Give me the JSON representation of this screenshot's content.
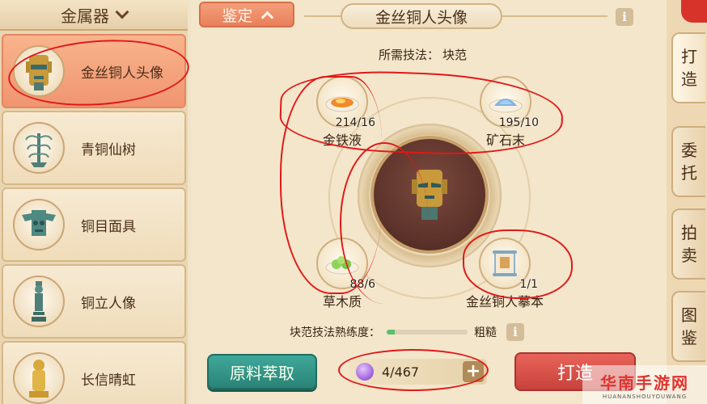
{
  "category": {
    "label": "金属器"
  },
  "items": [
    {
      "label": "金丝铜人头像"
    },
    {
      "label": "青铜仙树"
    },
    {
      "label": "铜目面具"
    },
    {
      "label": "铜立人像"
    },
    {
      "label": "长信晴虹"
    }
  ],
  "header": {
    "appraise_label": "鉴定",
    "title": "金丝铜人头像",
    "info_glyph": "i"
  },
  "technique": {
    "label": "所需技法：",
    "value": "块范"
  },
  "materials": [
    {
      "name": "金铁液",
      "count": "214/16",
      "icon": "molten-metal-icon"
    },
    {
      "name": "矿石末",
      "count": "195/10",
      "icon": "ore-powder-icon"
    },
    {
      "name": "草木质",
      "count": "88/6",
      "icon": "plant-matter-icon"
    },
    {
      "name": "金丝铜人摹本",
      "count": "1/1",
      "icon": "scroll-icon"
    }
  ],
  "proficiency": {
    "label": "块范技法熟练度：",
    "level": "粗糙",
    "fill_fraction": 0.1
  },
  "actions": {
    "extract_label": "原料萃取",
    "quantity": "4/467",
    "plus_glyph": "+",
    "craft_label": "打造"
  },
  "side_tabs": [
    {
      "chars": [
        "打",
        "造"
      ],
      "active": true
    },
    {
      "chars": [
        "委",
        "托"
      ],
      "active": false
    },
    {
      "chars": [
        "拍",
        "卖"
      ],
      "active": false
    },
    {
      "chars": [
        "图",
        "鉴"
      ],
      "active": false
    }
  ],
  "watermark": {
    "main": "华南手游网",
    "sub": "HUANANSHOUYOUWANG"
  },
  "colors": {
    "selected_item": "#f09570",
    "extract_button": "#2a8376",
    "craft_button": "#c8423c",
    "annotation_red": "#e21818"
  }
}
